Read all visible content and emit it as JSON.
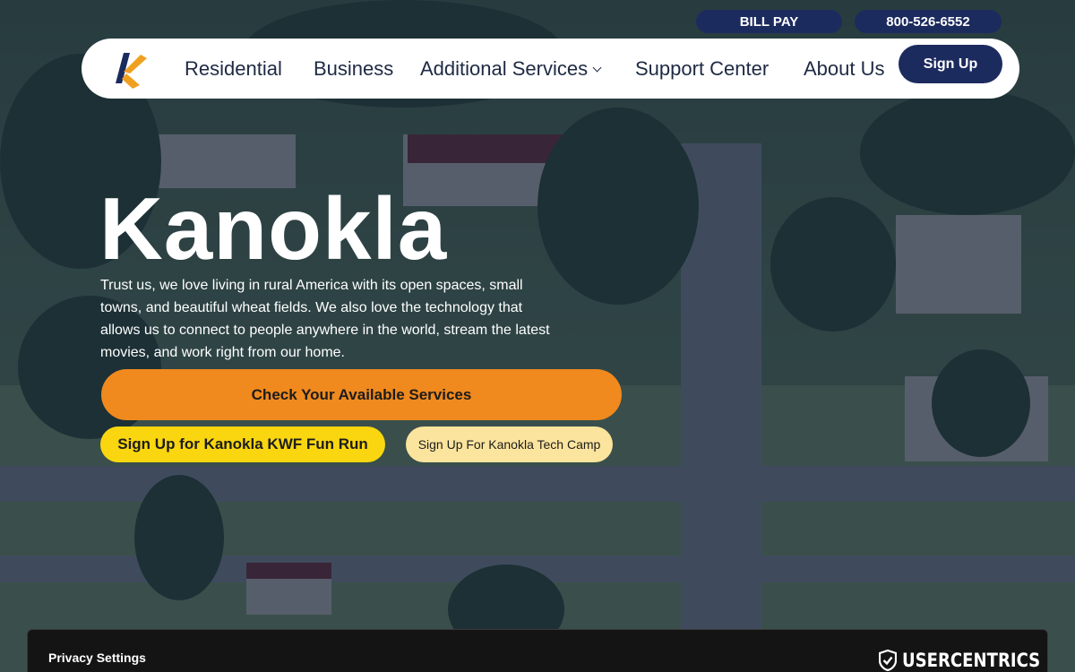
{
  "topbar": {
    "bill_pay": "BILL PAY",
    "phone": "800-526-6552"
  },
  "nav": {
    "logo_icon": "kanokla-logo-icon",
    "items": [
      {
        "label": "Residential"
      },
      {
        "label": "Business"
      },
      {
        "label": "Additional Services",
        "icon": "chevron-down-icon"
      },
      {
        "label": "Support Center"
      },
      {
        "label": "About Us"
      }
    ],
    "signup_label": "Sign Up"
  },
  "hero": {
    "title": "Kanokla",
    "description": "Trust us, we love living in rural America with its open spaces, small towns, and beautiful wheat fields. We also love the technology that allows us to connect to people anywhere in the world, stream the latest movies, and work right from our home.",
    "cta_main": "Check Your Available Services",
    "cta_run": "Sign Up for Kanokla KWF Fun Run",
    "cta_camp": "Sign Up For Kanokla Tech Camp"
  },
  "privacy_banner": {
    "title": "Privacy Settings",
    "brand": "USERCENTRICS",
    "brand_icon": "shield-check-icon"
  },
  "colors": {
    "navy": "#1c2b5e",
    "orange": "#f0891e",
    "yellow": "#f9d60f",
    "pale_yellow": "#fbe49d",
    "logo_blue": "#1c2b5e",
    "logo_orange": "#f0a020"
  }
}
